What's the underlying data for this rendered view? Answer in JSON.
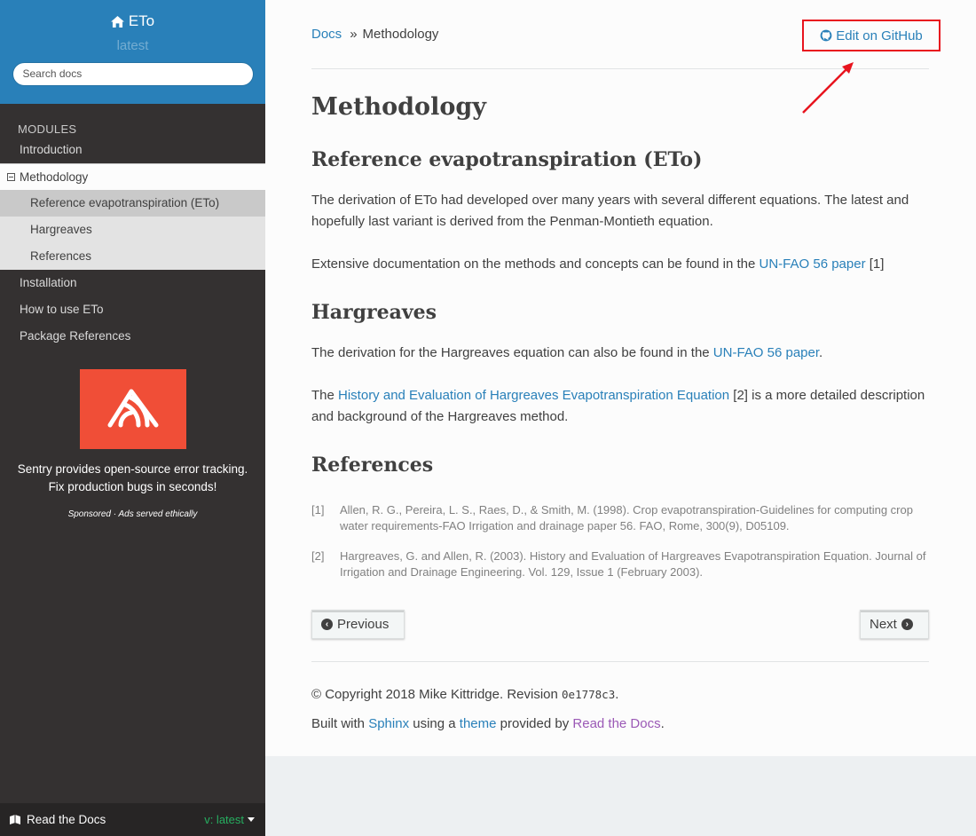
{
  "sidebar": {
    "project": "ETo",
    "version": "latest",
    "search_placeholder": "Search docs",
    "caption": "MODULES",
    "items": [
      {
        "label": "Introduction"
      },
      {
        "label": "Methodology"
      },
      {
        "label": "Installation"
      },
      {
        "label": "How to use ETo"
      },
      {
        "label": "Package References"
      }
    ],
    "subitems": [
      {
        "label": "Reference evapotranspiration (ETo)"
      },
      {
        "label": "Hargreaves"
      },
      {
        "label": "References"
      }
    ],
    "sponsor_line1": "Sentry provides open-source error tracking.",
    "sponsor_line2": "Fix production bugs in seconds!",
    "sponsored": "Sponsored · Ads served ethically",
    "rtd_label": "Read the Docs",
    "rtd_version": "v: latest"
  },
  "breadcrumb": {
    "root": "Docs",
    "separator": "»",
    "current": "Methodology",
    "edit_link": "Edit on GitHub"
  },
  "content": {
    "title": "Methodology",
    "section1": {
      "heading": "Reference evapotranspiration (ETo)",
      "p1": "The derivation of ETo had developed over many years with several different equations. The latest and hopefully last variant is derived from the Penman-Montieth equation.",
      "p2_before": "Extensive documentation on the methods and concepts can be found in the ",
      "p2_link": "UN-FAO 56 paper",
      "p2_after": " [1]"
    },
    "section2": {
      "heading": "Hargreaves",
      "p1_before": "The derivation for the Hargreaves equation can also be found in the ",
      "p1_link": "UN-FAO 56 paper",
      "p1_after": ".",
      "p2_before": "The ",
      "p2_link": "History and Evaluation of Hargreaves Evapotranspiration Equation",
      "p2_after": " [2] is a more detailed description and background of the Hargreaves method."
    },
    "section3": {
      "heading": "References",
      "refs": [
        {
          "num": "[1]",
          "text": "Allen, R. G., Pereira, L. S., Raes, D., & Smith, M. (1998). Crop evapotranspiration-Guidelines for computing crop water requirements-FAO Irrigation and drainage paper 56. FAO, Rome, 300(9), D05109."
        },
        {
          "num": "[2]",
          "text": "Hargreaves, G. and Allen, R. (2003). History and Evaluation of Hargreaves Evapotranspiration Equation. Journal of Irrigation and Drainage Engineering. Vol. 129, Issue 1 (February 2003)."
        }
      ]
    },
    "prev_label": "Previous",
    "next_label": "Next"
  },
  "footer": {
    "copyright_before": "© Copyright 2018 Mike Kittridge. Revision ",
    "revision": "0e1778c3",
    "copyright_after": ".",
    "built_before": "Built with ",
    "sphinx": "Sphinx",
    "built_mid1": " using a ",
    "theme": "theme",
    "built_mid2": " provided by ",
    "rtd": "Read the Docs",
    "built_after": "."
  },
  "colors": {
    "sidebar_header": "#2980b9",
    "sidebar_bg": "#343131",
    "link": "#2980b9",
    "visited_link": "#9b59b6",
    "highlight_box": "#e8141e",
    "sentry": "#f04e37"
  }
}
